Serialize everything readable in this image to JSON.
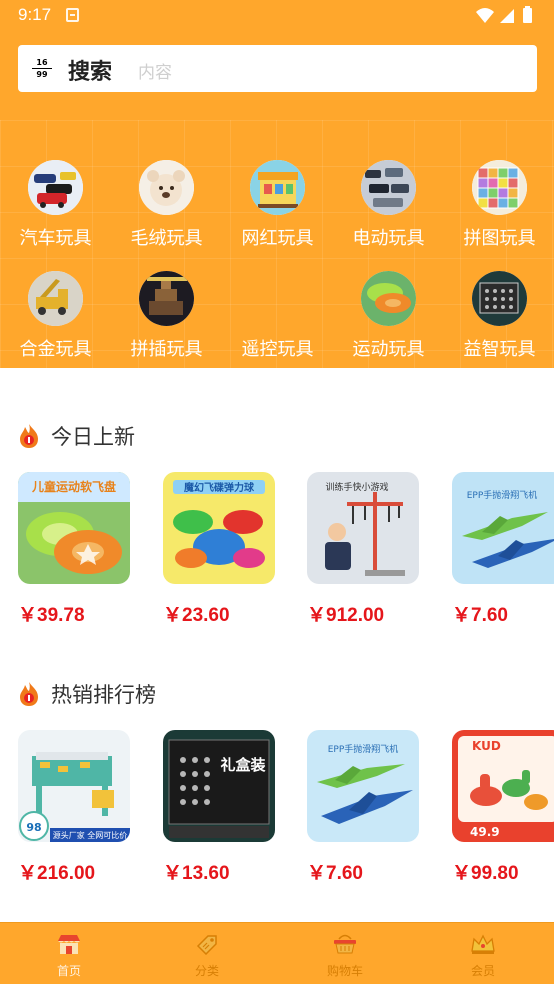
{
  "status_bar": {
    "time": "9:17"
  },
  "search": {
    "logo_top": "16",
    "logo_bottom": "99",
    "label": "搜索",
    "placeholder": "内容"
  },
  "categories": [
    {
      "label": "汽车玩具",
      "icon": "toy-cars"
    },
    {
      "label": "毛绒玩具",
      "icon": "plush-bear"
    },
    {
      "label": "网红玩具",
      "icon": "toy-stall"
    },
    {
      "label": "电动玩具",
      "icon": "rc-vehicles"
    },
    {
      "label": "拼图玩具",
      "icon": "puzzle"
    },
    {
      "label": "合金玩具",
      "icon": "alloy-truck"
    },
    {
      "label": "拼插玩具",
      "icon": "building-blocks"
    },
    {
      "label": "遥控玩具",
      "icon": ""
    },
    {
      "label": "运动玩具",
      "icon": "frisbee"
    },
    {
      "label": "益智玩具",
      "icon": "puzzle-box"
    }
  ],
  "sections": [
    {
      "title": "今日上新",
      "products": [
        {
          "price": "￥39.78",
          "image": "frisbee-set",
          "banner": "儿童运动软飞盘"
        },
        {
          "price": "￥23.60",
          "image": "ufo-balls",
          "banner": "魔幻飞碟弹力球"
        },
        {
          "price": "￥912.00",
          "image": "kids-training-stand",
          "banner": "训练手快小游戏"
        },
        {
          "price": "￥7.60",
          "image": "foam-plane",
          "banner": "EPP手抛滑翔飞机"
        }
      ]
    },
    {
      "title": "热销排行榜",
      "products": [
        {
          "price": "￥216.00",
          "image": "kids-table",
          "badge": "98",
          "caption": "源头厂家 全网可比价"
        },
        {
          "price": "￥13.60",
          "image": "gift-box-puzzle",
          "banner": "礼盒装"
        },
        {
          "price": "￥7.60",
          "image": "foam-plane",
          "banner": "EPP手抛滑翔飞机"
        },
        {
          "price": "￥99.80",
          "image": "dinosaur-toys",
          "brand": "KUD",
          "sub": "49.9"
        }
      ]
    }
  ],
  "tabs": [
    {
      "label": "首页",
      "icon": "home-shop-icon",
      "active": true
    },
    {
      "label": "分类",
      "icon": "category-tag-icon",
      "active": false
    },
    {
      "label": "购物车",
      "icon": "cart-icon",
      "active": false
    },
    {
      "label": "会员",
      "icon": "vip-crown-icon",
      "active": false
    }
  ],
  "colors": {
    "accent": "#ffa72c",
    "price": "#e5161b",
    "tab_text": "#d77f05"
  }
}
